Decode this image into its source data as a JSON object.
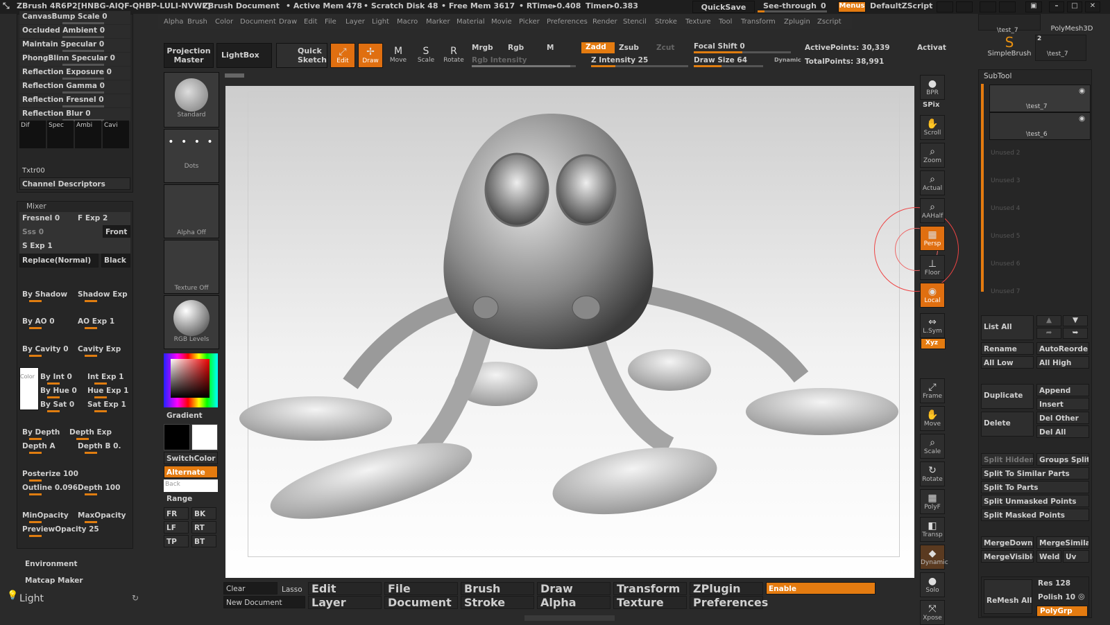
{
  "title_bar": {
    "app": "ZBrush 4R6",
    "license": "P2[HNBG-AIQF-QHBP-LULI-NVWL]",
    "document": "ZBrush Document",
    "active_mem": "• Active Mem 478",
    "scratch_disk": "• Scratch Disk 48",
    "free_mem": "• Free Mem 3617",
    "rtime": "• RTime▸0.408",
    "timer": "Timer▸0.383",
    "quicksave": "QuickSave",
    "see_through": "See-through",
    "see_through_value": "0",
    "menus": "Menus",
    "default_zscript": "DefaultZScript"
  },
  "menu": [
    "Alpha",
    "Brush",
    "Color",
    "Document",
    "Draw",
    "Edit",
    "File",
    "Layer",
    "Light",
    "Macro",
    "Marker",
    "Material",
    "Movie",
    "Picker",
    "Preferences",
    "Render",
    "Stencil",
    "Stroke",
    "Texture",
    "Tool",
    "Transform",
    "Zplugin",
    "Zscript"
  ],
  "toolbar": {
    "projection_master": "Projection Master",
    "lightbox": "LightBox",
    "quick_sketch": "Quick Sketch",
    "edit": "Edit",
    "draw": "Draw",
    "move": "Move",
    "scale": "Scale",
    "rotate": "Rotate",
    "mrgb": "Mrgb",
    "rgb": "Rgb",
    "m": "M",
    "zadd": "Zadd",
    "zsub": "Zsub",
    "zcut": "Zcut",
    "rgb_intensity": "Rgb Intensity",
    "z_intensity": "Z Intensity 25",
    "focal_shift": "Focal Shift 0",
    "draw_size": "Draw Size 64",
    "dynamic": "Dynamic",
    "active_points": "ActivePoints: 30,339",
    "total_points": "TotalPoints: 38,991",
    "activate": "Activat"
  },
  "left_panel": {
    "top_rows": [
      "CanvasBump Scale 0",
      "Occluded Ambient 0",
      "Maintain Specular 0",
      "PhongBlinn Specular 0",
      "Reflection Exposure 0",
      "Reflection Gamma 0",
      "Reflection Fresnel 0",
      "Reflection Blur 0"
    ],
    "channels": [
      "Dif",
      "Spec",
      "Ambi",
      "Cavi"
    ],
    "txtr": "Txtr00",
    "channel_descriptors": "Channel Descriptors",
    "mixer_title": "Mixer",
    "fresnel": "Fresnel 0",
    "f_exp": "F Exp 2",
    "sss": "Sss 0",
    "front": "Front",
    "s_exp": "S Exp 1",
    "replace": "Replace(Normal)",
    "black": "Black",
    "by_shadow": "By Shadow",
    "shadow_exp": "Shadow Exp",
    "by_ao": "By AO 0",
    "ao_exp": "AO Exp 1",
    "by_cavity": "By Cavity 0",
    "cavity_exp": "Cavity Exp",
    "color": "Color",
    "by_int": "By Int 0",
    "int_exp": "Int Exp 1",
    "by_hue": "By Hue 0",
    "hue_exp": "Hue Exp 1",
    "by_sat": "By Sat 0",
    "sat_exp": "Sat Exp 1",
    "by_depth": "By Depth",
    "depth_exp": "Depth Exp",
    "depth_a": "Depth A",
    "depth_b": "Depth B 0.",
    "posterize": "Posterize 100",
    "outline": "Outline 0.096",
    "depth": "Depth 100",
    "min_opacity": "MinOpacity",
    "max_opacity": "MaxOpacity",
    "preview_opacity": "PreviewOpacity 25",
    "environment": "Environment",
    "matcap_maker": "Matcap Maker",
    "light": "Light"
  },
  "shelf": {
    "standard": "Standard",
    "dots": "Dots",
    "alpha_off": "Alpha Off",
    "texture_off": "Texture Off",
    "rgb_levels": "RGB Levels",
    "gradient": "Gradient",
    "switch_color": "SwitchColor",
    "alternate": "Alternate",
    "back": "Back",
    "range": "Range",
    "views": [
      "FR",
      "BK",
      "LF",
      "RT",
      "TP",
      "BT"
    ]
  },
  "right_tools": [
    "BPR",
    "SPix",
    "Scroll",
    "Zoom",
    "Actual",
    "AAHalf",
    "Persp",
    "Floor",
    "Local",
    "L.Sym",
    "Xyz",
    "Frame",
    "Move",
    "Scale",
    "Rotate",
    "PolyF",
    "Transp",
    "Dynamic",
    "Solo",
    "Xpose"
  ],
  "subtool": {
    "top_tools": [
      "\\test_7",
      "PolyMesh3D",
      "SimpleBrush",
      "\\test_7"
    ],
    "top_count": "2",
    "title": "SubTool",
    "items": [
      "\\test_7",
      "\\test_6"
    ],
    "unused": [
      "Unused 2",
      "Unused 3",
      "Unused 4",
      "Unused 5",
      "Unused 6",
      "Unused 7"
    ],
    "list_all": "List All",
    "rename": "Rename",
    "auto_reorder": "AutoReorder",
    "all_low": "All Low",
    "all_high": "All High",
    "duplicate": "Duplicate",
    "append": "Append",
    "insert": "Insert",
    "delete": "Delete",
    "del_other": "Del Other",
    "del_all": "Del All",
    "split_hidden": "Split Hidden",
    "groups_split": "Groups Split",
    "split_similar": "Split To Similar Parts",
    "split_parts": "Split To Parts",
    "split_unmasked": "Split Unmasked Points",
    "split_masked": "Split Masked Points",
    "merge_down": "MergeDown",
    "merge_similar": "MergeSimilar",
    "merge_visible": "MergeVisible",
    "weld": "Weld",
    "uv": "Uv",
    "remesh_all": "ReMesh All",
    "res": "Res 128",
    "polish": "Polish 10",
    "polygrp": "PolyGrp"
  },
  "bottom": {
    "clear": "Clear",
    "lasso": "Lasso",
    "new_document": "New Document",
    "menus": [
      "Edit",
      "File",
      "Brush",
      "Draw",
      "Transform",
      "ZPlugin",
      "Layer",
      "Document",
      "Stroke",
      "Alpha",
      "Texture",
      "Preferences"
    ],
    "enable": "Enable"
  },
  "colors": {
    "accent": "#e47b10",
    "bg": "#2a2a2a",
    "panel": "#262626"
  }
}
